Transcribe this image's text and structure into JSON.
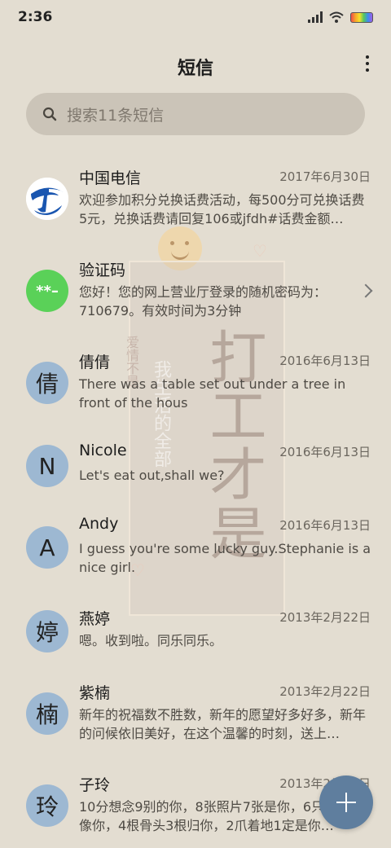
{
  "status_bar": {
    "time": "2:36"
  },
  "header": {
    "title": "短信",
    "menu_icon": "more-vertical-icon"
  },
  "search": {
    "placeholder": "搜索11条短信",
    "icon": "search-icon"
  },
  "wallpaper": {
    "big_text": "打工才是",
    "small_text": "我生活的全部",
    "tiny_text": "爱情不是"
  },
  "conversations": [
    {
      "name": "中国电信",
      "date": "2017年6月30日",
      "preview": "欢迎参加积分兑换话费活动，每500分可兑换话费5元，兑换话费请回复106或jfdh#话费金额…",
      "avatar_text": "",
      "avatar_color": "#ffffff"
    },
    {
      "name": "验证码",
      "date": "",
      "preview": "您好！您的网上营业厅登录的随机密码为：710679。有效时间为3分钟",
      "avatar_text": "**–",
      "avatar_color": "#5ad158"
    },
    {
      "name": "倩倩",
      "date": "2016年6月13日",
      "preview": "There was a table set out under a tree in front of the hous",
      "avatar_text": "倩",
      "avatar_color": "#9db8d2"
    },
    {
      "name": "Nicole",
      "date": "2016年6月13日",
      "preview": "Let's eat out,shall we?",
      "avatar_text": "N",
      "avatar_color": "#9db8d2"
    },
    {
      "name": "Andy",
      "date": "2016年6月13日",
      "preview": "I guess you're some lucky guy.Stephanie is a nice girl.",
      "avatar_text": "A",
      "avatar_color": "#9db8d2"
    },
    {
      "name": "燕婷",
      "date": "2013年2月22日",
      "preview": "嗯。收到啦。同乐同乐。",
      "avatar_text": "婷",
      "avatar_color": "#9db8d2"
    },
    {
      "name": "紫楠",
      "date": "2013年2月22日",
      "preview": "新年的祝福数不胜数，新年的愿望好多好多，新年的问候依旧美好，在这个温馨的时刻，送上…",
      "avatar_text": "楠",
      "avatar_color": "#9db8d2"
    },
    {
      "name": "子玲",
      "date": "2013年2月22日",
      "preview": "10分想念9别的你，8张照片7张是你，6只手只像你，4根骨头3根归你，2爪着地1定是你…",
      "avatar_text": "玲",
      "avatar_color": "#9db8d2"
    }
  ],
  "fab": {
    "icon": "plus-icon"
  }
}
